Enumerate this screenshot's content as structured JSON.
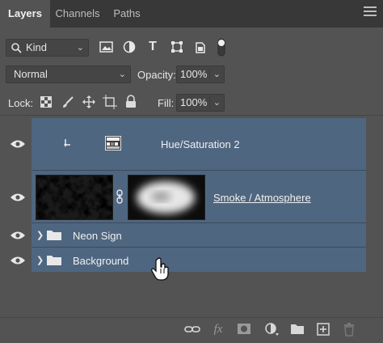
{
  "tabs": [
    {
      "label": "Layers",
      "active": true
    },
    {
      "label": "Channels",
      "active": false
    },
    {
      "label": "Paths",
      "active": false
    }
  ],
  "filter": {
    "kind_label": "Kind"
  },
  "blend": {
    "mode": "Normal",
    "opacity_label": "Opacity:",
    "opacity_value": "100%"
  },
  "lock": {
    "label": "Lock:",
    "fill_label": "Fill:",
    "fill_value": "100%"
  },
  "layers": [
    {
      "name": "Hue/Saturation 2",
      "type": "adjustment",
      "visible": true
    },
    {
      "name": "Smoke / Atmosphere",
      "type": "smart-object-masked",
      "visible": true
    },
    {
      "name": "Neon Sign",
      "type": "group",
      "visible": true
    },
    {
      "name": "Background",
      "type": "group",
      "visible": true
    }
  ],
  "bottom_bar_icons": [
    "link-icon",
    "fx-icon",
    "mask-icon",
    "adjustment-icon",
    "folder-icon",
    "new-layer-icon",
    "trash-icon"
  ],
  "colors": {
    "panel": "#535353",
    "selected_layer": "#4f6680",
    "tabbar": "#383838"
  }
}
